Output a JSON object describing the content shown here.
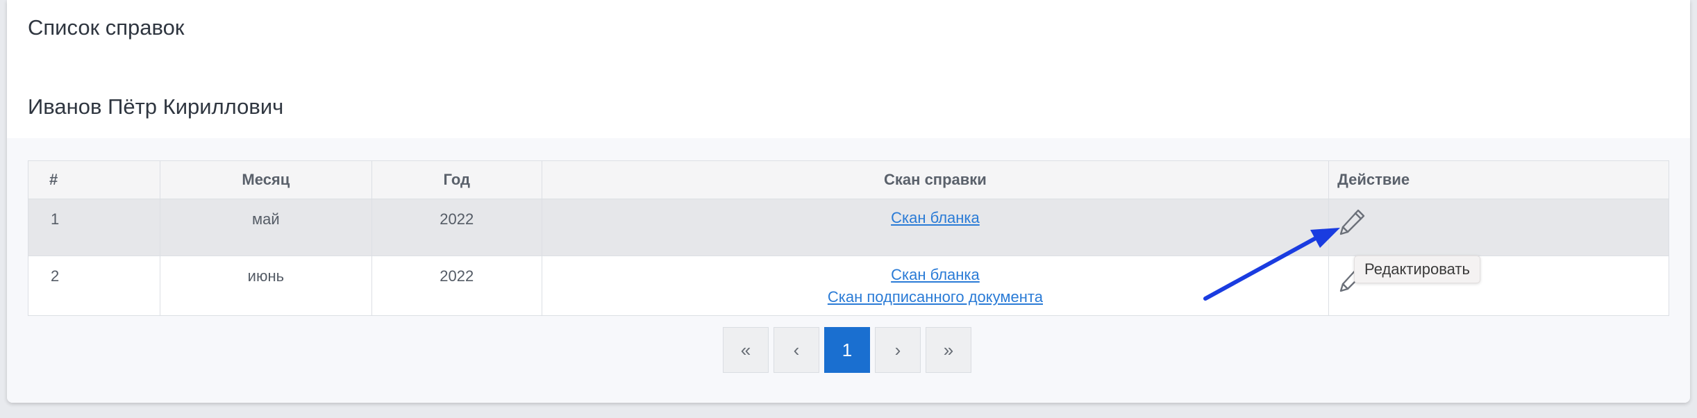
{
  "header": {
    "title": "Список справок",
    "person": "Иванов Пётр Кириллович"
  },
  "table": {
    "columns": [
      "#",
      "Месяц",
      "Год",
      "Скан справки",
      "Действие"
    ],
    "rows": [
      {
        "num": "1",
        "month": "май",
        "year": "2022",
        "scans": [
          "Скан бланка"
        ]
      },
      {
        "num": "2",
        "month": "июнь",
        "year": "2022",
        "scans": [
          "Скан бланка",
          "Скан подписанного документа"
        ]
      }
    ]
  },
  "pagination": {
    "first": "«",
    "prev": "‹",
    "current": "1",
    "next": "›",
    "last": "»"
  },
  "tooltip": {
    "text": "Редактировать"
  },
  "icons": {
    "edit": "pencil-icon",
    "annotation": "arrow-annotation"
  },
  "colors": {
    "link": "#2a7bd6",
    "active_page": "#1a6fd0",
    "arrow": "#1a3ce0"
  }
}
